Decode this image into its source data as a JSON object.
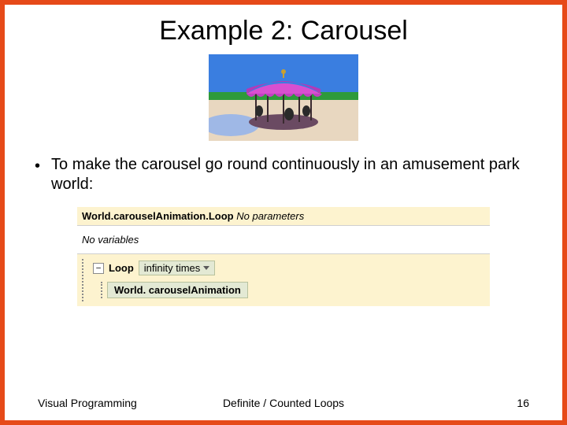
{
  "title": "Example 2: Carousel",
  "bullet": "To make the carousel go round continuously in an amusement park world:",
  "code": {
    "method_owner": "World.",
    "method_name": "carouselAnimation.Loop",
    "params_label": "No parameters",
    "vars_label": "No variables",
    "loop_label": "Loop",
    "infinity_label": "infinity times",
    "inner_call": "World. carouselAnimation"
  },
  "footer": {
    "left": "Visual Programming",
    "center": "Definite / Counted Loops",
    "page": "16"
  }
}
